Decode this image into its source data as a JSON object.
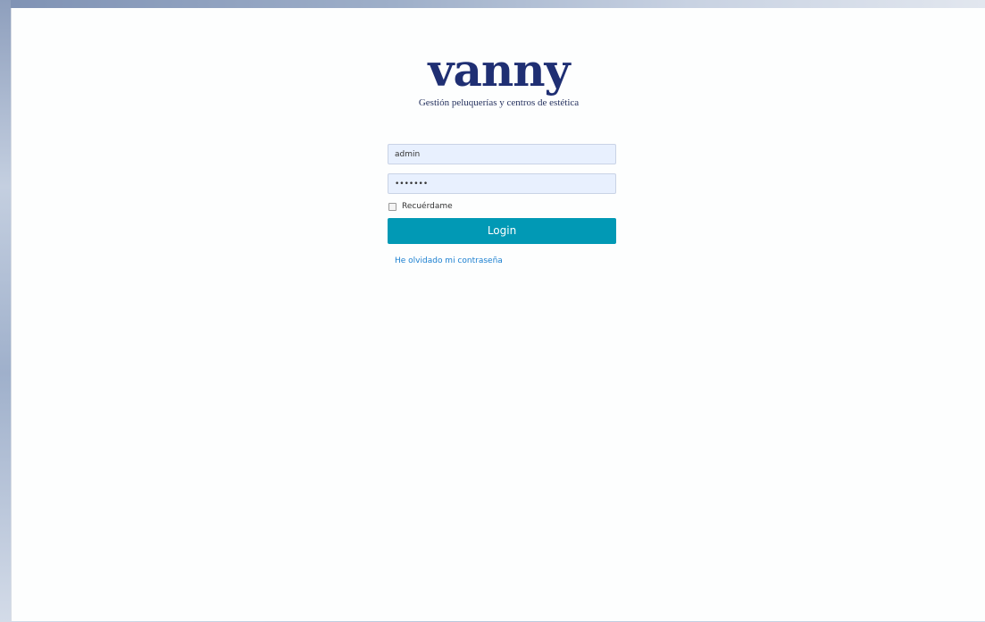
{
  "brand": {
    "logo_text": "vanny",
    "tagline": "Gestión peluquerías y centros de estética"
  },
  "login_form": {
    "username_value": "admin",
    "password_value": "•••••••",
    "remember_label": "Recuérdame",
    "remember_checked": false,
    "submit_label": "Login",
    "forgot_password_label": "He olvidado mi contraseña"
  },
  "colors": {
    "brand": "#1f2f73",
    "button": "#0199b5",
    "link": "#1a7fd0",
    "autofill_field": "#e8f0fe"
  }
}
